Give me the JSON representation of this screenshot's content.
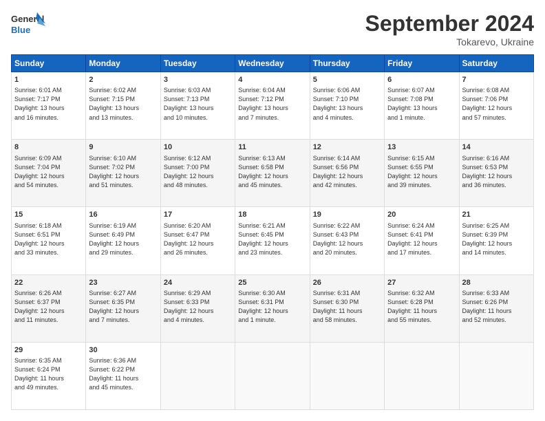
{
  "header": {
    "logo_line1": "General",
    "logo_line2": "Blue",
    "month": "September 2024",
    "location": "Tokarevo, Ukraine"
  },
  "weekdays": [
    "Sunday",
    "Monday",
    "Tuesday",
    "Wednesday",
    "Thursday",
    "Friday",
    "Saturday"
  ],
  "weeks": [
    [
      {
        "day": "1",
        "info": "Sunrise: 6:01 AM\nSunset: 7:17 PM\nDaylight: 13 hours\nand 16 minutes."
      },
      {
        "day": "2",
        "info": "Sunrise: 6:02 AM\nSunset: 7:15 PM\nDaylight: 13 hours\nand 13 minutes."
      },
      {
        "day": "3",
        "info": "Sunrise: 6:03 AM\nSunset: 7:13 PM\nDaylight: 13 hours\nand 10 minutes."
      },
      {
        "day": "4",
        "info": "Sunrise: 6:04 AM\nSunset: 7:12 PM\nDaylight: 13 hours\nand 7 minutes."
      },
      {
        "day": "5",
        "info": "Sunrise: 6:06 AM\nSunset: 7:10 PM\nDaylight: 13 hours\nand 4 minutes."
      },
      {
        "day": "6",
        "info": "Sunrise: 6:07 AM\nSunset: 7:08 PM\nDaylight: 13 hours\nand 1 minute."
      },
      {
        "day": "7",
        "info": "Sunrise: 6:08 AM\nSunset: 7:06 PM\nDaylight: 12 hours\nand 57 minutes."
      }
    ],
    [
      {
        "day": "8",
        "info": "Sunrise: 6:09 AM\nSunset: 7:04 PM\nDaylight: 12 hours\nand 54 minutes."
      },
      {
        "day": "9",
        "info": "Sunrise: 6:10 AM\nSunset: 7:02 PM\nDaylight: 12 hours\nand 51 minutes."
      },
      {
        "day": "10",
        "info": "Sunrise: 6:12 AM\nSunset: 7:00 PM\nDaylight: 12 hours\nand 48 minutes."
      },
      {
        "day": "11",
        "info": "Sunrise: 6:13 AM\nSunset: 6:58 PM\nDaylight: 12 hours\nand 45 minutes."
      },
      {
        "day": "12",
        "info": "Sunrise: 6:14 AM\nSunset: 6:56 PM\nDaylight: 12 hours\nand 42 minutes."
      },
      {
        "day": "13",
        "info": "Sunrise: 6:15 AM\nSunset: 6:55 PM\nDaylight: 12 hours\nand 39 minutes."
      },
      {
        "day": "14",
        "info": "Sunrise: 6:16 AM\nSunset: 6:53 PM\nDaylight: 12 hours\nand 36 minutes."
      }
    ],
    [
      {
        "day": "15",
        "info": "Sunrise: 6:18 AM\nSunset: 6:51 PM\nDaylight: 12 hours\nand 33 minutes."
      },
      {
        "day": "16",
        "info": "Sunrise: 6:19 AM\nSunset: 6:49 PM\nDaylight: 12 hours\nand 29 minutes."
      },
      {
        "day": "17",
        "info": "Sunrise: 6:20 AM\nSunset: 6:47 PM\nDaylight: 12 hours\nand 26 minutes."
      },
      {
        "day": "18",
        "info": "Sunrise: 6:21 AM\nSunset: 6:45 PM\nDaylight: 12 hours\nand 23 minutes."
      },
      {
        "day": "19",
        "info": "Sunrise: 6:22 AM\nSunset: 6:43 PM\nDaylight: 12 hours\nand 20 minutes."
      },
      {
        "day": "20",
        "info": "Sunrise: 6:24 AM\nSunset: 6:41 PM\nDaylight: 12 hours\nand 17 minutes."
      },
      {
        "day": "21",
        "info": "Sunrise: 6:25 AM\nSunset: 6:39 PM\nDaylight: 12 hours\nand 14 minutes."
      }
    ],
    [
      {
        "day": "22",
        "info": "Sunrise: 6:26 AM\nSunset: 6:37 PM\nDaylight: 12 hours\nand 11 minutes."
      },
      {
        "day": "23",
        "info": "Sunrise: 6:27 AM\nSunset: 6:35 PM\nDaylight: 12 hours\nand 7 minutes."
      },
      {
        "day": "24",
        "info": "Sunrise: 6:29 AM\nSunset: 6:33 PM\nDaylight: 12 hours\nand 4 minutes."
      },
      {
        "day": "25",
        "info": "Sunrise: 6:30 AM\nSunset: 6:31 PM\nDaylight: 12 hours\nand 1 minute."
      },
      {
        "day": "26",
        "info": "Sunrise: 6:31 AM\nSunset: 6:30 PM\nDaylight: 11 hours\nand 58 minutes."
      },
      {
        "day": "27",
        "info": "Sunrise: 6:32 AM\nSunset: 6:28 PM\nDaylight: 11 hours\nand 55 minutes."
      },
      {
        "day": "28",
        "info": "Sunrise: 6:33 AM\nSunset: 6:26 PM\nDaylight: 11 hours\nand 52 minutes."
      }
    ],
    [
      {
        "day": "29",
        "info": "Sunrise: 6:35 AM\nSunset: 6:24 PM\nDaylight: 11 hours\nand 49 minutes."
      },
      {
        "day": "30",
        "info": "Sunrise: 6:36 AM\nSunset: 6:22 PM\nDaylight: 11 hours\nand 45 minutes."
      },
      {
        "day": "",
        "info": ""
      },
      {
        "day": "",
        "info": ""
      },
      {
        "day": "",
        "info": ""
      },
      {
        "day": "",
        "info": ""
      },
      {
        "day": "",
        "info": ""
      }
    ]
  ]
}
